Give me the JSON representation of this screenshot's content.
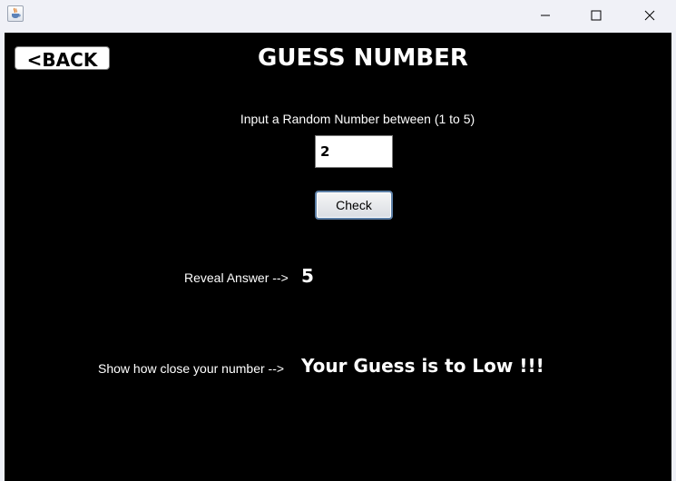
{
  "titlebar": {
    "icons": {
      "app": "java-cup-icon",
      "minimize": "minimize-icon",
      "maximize": "maximize-icon",
      "close": "close-icon"
    }
  },
  "header": {
    "back_label": "<BACK",
    "title": "GUESS NUMBER"
  },
  "form": {
    "prompt": "Input a Random Number between (1 to 5)",
    "input_value": "2",
    "check_label": "Check"
  },
  "results": {
    "reveal_label": "Reveal Answer -->",
    "reveal_value": "5",
    "closeness_label": "Show how close your number -->",
    "closeness_value": "Your Guess is to Low !!!"
  },
  "colors": {
    "background": "#000000",
    "text": "#ffffff",
    "titlebar": "#f0f1f7"
  }
}
